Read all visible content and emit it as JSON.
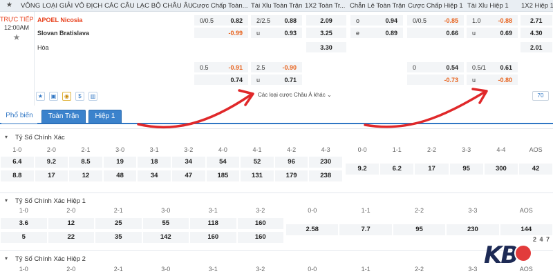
{
  "header": {
    "league": "VÔNG LOẠI GIẢI VÔ ĐỊCH CÁC CÂU LẠC BỘ CHÂU ÂU",
    "columns": [
      "Cược Chấp Toàn...",
      "Tài Xỉu Toàn Trận",
      "1X2 Toàn Tr...",
      "Chẵn Lẻ Toàn Trận",
      "Cược Chấp Hiệp 1",
      "Tài Xỉu Hiệp 1",
      "1X2 Hiệp 1"
    ]
  },
  "match": {
    "status": "TRỰC TIẾP",
    "time": "12:00AM",
    "home": "APOEL Nicosia",
    "away": "Slovan Bratislava",
    "draw": "Hòa",
    "main_odds": {
      "hdp_ft": {
        "line": "0/0.5",
        "home": "0.82",
        "away": "-0.99"
      },
      "ou_ft": {
        "line": "2/2.5",
        "over": "0.88",
        "under_label": "u",
        "under": "0.93"
      },
      "x12_ft": {
        "home": "2.09",
        "away": "3.25",
        "draw": "3.30"
      },
      "oe_ft": {
        "odd_label": "o",
        "odd": "0.94",
        "even_label": "e",
        "even": "0.89"
      },
      "hdp_h1": {
        "line": "0/0.5",
        "home": "-0.85",
        "away": "0.66"
      },
      "ou_h1": {
        "line": "1.0",
        "over": "-0.88",
        "under_label": "u",
        "under": "0.69"
      },
      "x12_h1": {
        "home": "2.71",
        "away": "4.30",
        "draw": "2.01"
      }
    },
    "alt_odds": {
      "hdp_ft": {
        "line": "0.5",
        "home": "-0.91",
        "away": "0.74"
      },
      "ou_ft": {
        "line": "2.5",
        "over": "-0.90",
        "under_label": "u",
        "under": "0.71"
      },
      "hdp_h1": {
        "line": "0",
        "home": "0.54",
        "away": "-0.73"
      },
      "ou_h1": {
        "line": "0.5/1",
        "over": "0.61",
        "under_label": "u",
        "under": "-0.80"
      }
    },
    "more_label": "Các loại cược Châu Á khác",
    "page_count": "70",
    "tool_icons": [
      "star-icon",
      "tv-icon",
      "coin-icon",
      "dollar-icon",
      "stats-icon"
    ]
  },
  "tabs": {
    "popular": "Phổ biến",
    "full": "Toàn Trận",
    "half": "Hiệp 1"
  },
  "correct_score": {
    "title": "Tỷ Số Chính Xác",
    "headers": [
      "1-0",
      "2-0",
      "2-1",
      "3-0",
      "3-1",
      "3-2",
      "4-0",
      "4-1",
      "4-2",
      "4-3",
      "0-0",
      "1-1",
      "2-2",
      "3-3",
      "4-4",
      "AOS"
    ],
    "home_row": [
      "6.4",
      "9.2",
      "8.5",
      "19",
      "18",
      "34",
      "54",
      "52",
      "96",
      "230"
    ],
    "away_row": [
      "8.8",
      "17",
      "12",
      "48",
      "34",
      "47",
      "185",
      "131",
      "179",
      "238"
    ],
    "draw_row": [
      "9.2",
      "6.2",
      "17",
      "95",
      "300",
      "42"
    ]
  },
  "correct_score_h1": {
    "title": "Tỷ Số Chính Xác Hiệp 1",
    "headers": [
      "1-0",
      "2-0",
      "2-1",
      "3-0",
      "3-1",
      "3-2",
      "0-0",
      "1-1",
      "2-2",
      "3-3",
      "AOS"
    ],
    "home_row": [
      "3.6",
      "12",
      "25",
      "55",
      "118",
      "160"
    ],
    "away_row": [
      "5",
      "22",
      "35",
      "142",
      "160",
      "160"
    ],
    "draw_row": [
      "2.58",
      "7.7",
      "95",
      "230",
      "144"
    ]
  },
  "correct_score_h2": {
    "title": "Tỷ Số Chính Xác Hiệp 2",
    "headers": [
      "1-0",
      "2-0",
      "2-1",
      "3-0",
      "3-1",
      "3-2",
      "0-0",
      "1-1",
      "2-2",
      "3-3",
      "AOS"
    ]
  },
  "logo": {
    "brand": "KB",
    "number": "2 4 7"
  },
  "colors": {
    "accent": "#2f76c4",
    "negative": "#e8621c",
    "live": "#e8401c",
    "arrow": "#e0282a"
  }
}
